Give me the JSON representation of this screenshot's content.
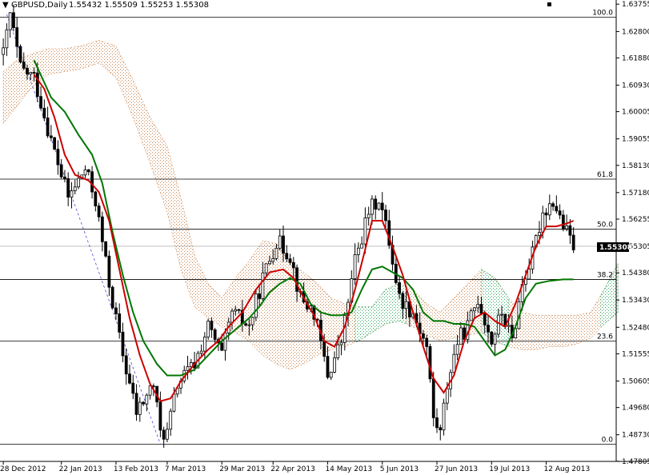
{
  "header": {
    "symbol_label": "GBPUSD,Daily",
    "ohlc": "1.55432 1.55509 1.55253 1.55308",
    "close_icon": "close-icon"
  },
  "price_label": "1.55308",
  "colors": {
    "background": "#ffffff",
    "candle": "#000000",
    "candle_body_bull": "#ffffff",
    "tenkan": "#cc0000",
    "kijun": "#007700",
    "senkou_a_fill": "#cc8855",
    "senkou_b_fill": "#33aa66",
    "fib_line": "#000000",
    "price_box": "#000000",
    "trend_line": "#3333cc"
  },
  "chart_data": {
    "type": "candlestick",
    "symbol": "GBPUSD",
    "timeframe": "Daily",
    "ylim": [
      1.478,
      1.639
    ],
    "y_ticks": [
      "1.63755",
      "1.62800",
      "1.61880",
      "1.60930",
      "1.60005",
      "1.59055",
      "1.58130",
      "1.57180",
      "1.56255",
      "1.55305",
      "1.54380",
      "1.53430",
      "1.52480",
      "1.51555",
      "1.50605",
      "1.49680",
      "1.48730",
      "1.47805"
    ],
    "x_ticks": [
      "28 Dec 2012",
      "22 Jan 2013",
      "13 Feb 2013",
      "7 Mar 2013",
      "29 Mar 2013",
      "22 Apr 2013",
      "14 May 2013",
      "5 Jun 2013",
      "27 Jun 2013",
      "19 Jul 2013",
      "12 Aug 2013"
    ],
    "x_tick_index": [
      0,
      17,
      33,
      48,
      64,
      79,
      95,
      111,
      127,
      143,
      159
    ],
    "num_bars": 180,
    "fib_levels": [
      {
        "label": "100.0",
        "price": 1.633
      },
      {
        "label": "61.8",
        "price": 1.5765
      },
      {
        "label": "50.0",
        "price": 1.559
      },
      {
        "label": "38.2",
        "price": 1.5415
      },
      {
        "label": "23.6",
        "price": 1.52
      },
      {
        "label": "0.0",
        "price": 1.484
      }
    ],
    "current_price": 1.55308,
    "price_path": [
      [
        0,
        1.62
      ],
      [
        2,
        1.634
      ],
      [
        5,
        1.615
      ],
      [
        9,
        1.612
      ],
      [
        14,
        1.59
      ],
      [
        19,
        1.57
      ],
      [
        24,
        1.58
      ],
      [
        27,
        1.569
      ],
      [
        31,
        1.54
      ],
      [
        35,
        1.515
      ],
      [
        39,
        1.495
      ],
      [
        44,
        1.505
      ],
      [
        46,
        1.488
      ],
      [
        48,
        1.488
      ],
      [
        51,
        1.505
      ],
      [
        56,
        1.512
      ],
      [
        60,
        1.525
      ],
      [
        64,
        1.515
      ],
      [
        67,
        1.53
      ],
      [
        72,
        1.525
      ],
      [
        76,
        1.542
      ],
      [
        80,
        1.555
      ],
      [
        84,
        1.55
      ],
      [
        87,
        1.535
      ],
      [
        91,
        1.53
      ],
      [
        95,
        1.508
      ],
      [
        99,
        1.52
      ],
      [
        103,
        1.548
      ],
      [
        107,
        1.565
      ],
      [
        110,
        1.57
      ],
      [
        113,
        1.555
      ],
      [
        116,
        1.535
      ],
      [
        120,
        1.53
      ],
      [
        124,
        1.518
      ],
      [
        126,
        1.493
      ],
      [
        128,
        1.488
      ],
      [
        130,
        1.505
      ],
      [
        133,
        1.52
      ],
      [
        136,
        1.525
      ],
      [
        139,
        1.535
      ],
      [
        143,
        1.52
      ],
      [
        146,
        1.53
      ],
      [
        149,
        1.52
      ],
      [
        152,
        1.54
      ],
      [
        155,
        1.55
      ],
      [
        158,
        1.565
      ],
      [
        161,
        1.569
      ],
      [
        164,
        1.56
      ],
      [
        167,
        1.5531
      ]
    ],
    "tenkan_path": [
      [
        9,
        1.613
      ],
      [
        12,
        1.608
      ],
      [
        15,
        1.598
      ],
      [
        18,
        1.585
      ],
      [
        21,
        1.578
      ],
      [
        25,
        1.576
      ],
      [
        28,
        1.572
      ],
      [
        31,
        1.562
      ],
      [
        34,
        1.545
      ],
      [
        37,
        1.528
      ],
      [
        40,
        1.515
      ],
      [
        43,
        1.505
      ],
      [
        46,
        1.499
      ],
      [
        49,
        1.5
      ],
      [
        52,
        1.506
      ],
      [
        56,
        1.512
      ],
      [
        60,
        1.517
      ],
      [
        63,
        1.52
      ],
      [
        66,
        1.525
      ],
      [
        70,
        1.53
      ],
      [
        74,
        1.538
      ],
      [
        78,
        1.544
      ],
      [
        82,
        1.545
      ],
      [
        85,
        1.542
      ],
      [
        88,
        1.535
      ],
      [
        91,
        1.529
      ],
      [
        94,
        1.52
      ],
      [
        97,
        1.518
      ],
      [
        100,
        1.525
      ],
      [
        103,
        1.538
      ],
      [
        106,
        1.552
      ],
      [
        108,
        1.562
      ],
      [
        111,
        1.562
      ],
      [
        114,
        1.553
      ],
      [
        117,
        1.543
      ],
      [
        120,
        1.53
      ],
      [
        123,
        1.518
      ],
      [
        126,
        1.507
      ],
      [
        129,
        1.502
      ],
      [
        132,
        1.508
      ],
      [
        135,
        1.52
      ],
      [
        138,
        1.528
      ],
      [
        141,
        1.53
      ],
      [
        144,
        1.527
      ],
      [
        147,
        1.525
      ],
      [
        150,
        1.533
      ],
      [
        153,
        1.543
      ],
      [
        156,
        1.553
      ],
      [
        159,
        1.56
      ],
      [
        162,
        1.56
      ],
      [
        165,
        1.561
      ],
      [
        167,
        1.562
      ]
    ],
    "kijun_path": [
      [
        9,
        1.618
      ],
      [
        14,
        1.605
      ],
      [
        18,
        1.6
      ],
      [
        22,
        1.592
      ],
      [
        26,
        1.585
      ],
      [
        29,
        1.575
      ],
      [
        32,
        1.558
      ],
      [
        35,
        1.543
      ],
      [
        38,
        1.53
      ],
      [
        41,
        1.52
      ],
      [
        45,
        1.512
      ],
      [
        48,
        1.508
      ],
      [
        52,
        1.508
      ],
      [
        56,
        1.51
      ],
      [
        60,
        1.515
      ],
      [
        64,
        1.52
      ],
      [
        68,
        1.524
      ],
      [
        72,
        1.528
      ],
      [
        75,
        1.532
      ],
      [
        78,
        1.537
      ],
      [
        81,
        1.54
      ],
      [
        84,
        1.542
      ],
      [
        87,
        1.54
      ],
      [
        90,
        1.533
      ],
      [
        93,
        1.53
      ],
      [
        96,
        1.529
      ],
      [
        99,
        1.529
      ],
      [
        102,
        1.53
      ],
      [
        105,
        1.538
      ],
      [
        108,
        1.545
      ],
      [
        111,
        1.546
      ],
      [
        114,
        1.544
      ],
      [
        117,
        1.542
      ],
      [
        120,
        1.538
      ],
      [
        123,
        1.53
      ],
      [
        126,
        1.527
      ],
      [
        129,
        1.527
      ],
      [
        132,
        1.526
      ],
      [
        135,
        1.526
      ],
      [
        138,
        1.525
      ],
      [
        141,
        1.52
      ],
      [
        144,
        1.515
      ],
      [
        147,
        1.517
      ],
      [
        150,
        1.525
      ],
      [
        153,
        1.535
      ],
      [
        156,
        1.54
      ],
      [
        160,
        1.541
      ],
      [
        164,
        1.5415
      ],
      [
        167,
        1.5415
      ]
    ],
    "cloud_upper": [
      [
        0,
        1.614
      ],
      [
        4,
        1.618
      ],
      [
        8,
        1.62
      ],
      [
        13,
        1.622
      ],
      [
        18,
        1.622
      ],
      [
        23,
        1.623
      ],
      [
        28,
        1.625
      ],
      [
        33,
        1.623
      ],
      [
        38,
        1.611
      ],
      [
        43,
        1.598
      ],
      [
        48,
        1.588
      ],
      [
        52,
        1.57
      ],
      [
        56,
        1.55
      ],
      [
        60,
        1.54
      ],
      [
        64,
        1.535
      ],
      [
        68,
        1.542
      ],
      [
        72,
        1.548
      ],
      [
        76,
        1.555
      ],
      [
        80,
        1.554
      ],
      [
        84,
        1.547
      ],
      [
        88,
        1.544
      ],
      [
        92,
        1.54
      ],
      [
        96,
        1.535
      ],
      [
        100,
        1.533
      ],
      [
        104,
        1.532
      ],
      [
        108,
        1.532
      ],
      [
        112,
        1.538
      ],
      [
        116,
        1.54
      ],
      [
        120,
        1.538
      ],
      [
        124,
        1.533
      ],
      [
        128,
        1.53
      ],
      [
        132,
        1.535
      ],
      [
        136,
        1.54
      ],
      [
        140,
        1.545
      ],
      [
        144,
        1.542
      ],
      [
        148,
        1.535
      ],
      [
        152,
        1.53
      ],
      [
        156,
        1.529
      ],
      [
        160,
        1.529
      ],
      [
        164,
        1.529
      ],
      [
        168,
        1.529
      ],
      [
        172,
        1.53
      ],
      [
        176,
        1.538
      ],
      [
        180,
        1.547
      ]
    ],
    "cloud_lower": [
      [
        0,
        1.596
      ],
      [
        4,
        1.602
      ],
      [
        8,
        1.608
      ],
      [
        13,
        1.613
      ],
      [
        18,
        1.614
      ],
      [
        23,
        1.615
      ],
      [
        28,
        1.617
      ],
      [
        33,
        1.612
      ],
      [
        38,
        1.598
      ],
      [
        43,
        1.582
      ],
      [
        48,
        1.565
      ],
      [
        52,
        1.545
      ],
      [
        56,
        1.532
      ],
      [
        60,
        1.528
      ],
      [
        64,
        1.525
      ],
      [
        68,
        1.523
      ],
      [
        72,
        1.52
      ],
      [
        76,
        1.515
      ],
      [
        80,
        1.512
      ],
      [
        84,
        1.51
      ],
      [
        88,
        1.512
      ],
      [
        92,
        1.515
      ],
      [
        96,
        1.517
      ],
      [
        100,
        1.518
      ],
      [
        104,
        1.52
      ],
      [
        108,
        1.523
      ],
      [
        112,
        1.526
      ],
      [
        116,
        1.527
      ],
      [
        120,
        1.525
      ],
      [
        124,
        1.522
      ],
      [
        128,
        1.52
      ],
      [
        132,
        1.521
      ],
      [
        136,
        1.522
      ],
      [
        140,
        1.523
      ],
      [
        144,
        1.52
      ],
      [
        148,
        1.518
      ],
      [
        152,
        1.517
      ],
      [
        156,
        1.517
      ],
      [
        160,
        1.518
      ],
      [
        164,
        1.518
      ],
      [
        168,
        1.519
      ],
      [
        172,
        1.521
      ],
      [
        176,
        1.526
      ],
      [
        180,
        1.53
      ]
    ],
    "trend_line": [
      [
        1,
        1.634
      ],
      [
        46,
        1.484
      ]
    ]
  }
}
